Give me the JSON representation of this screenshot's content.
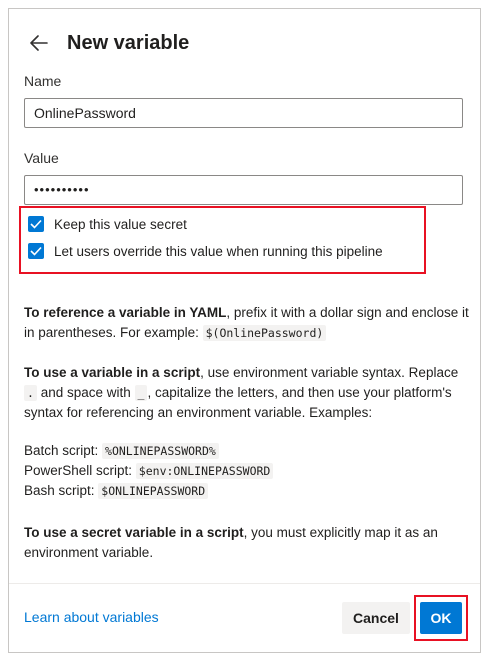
{
  "header": {
    "title": "New variable"
  },
  "name_field": {
    "label": "Name",
    "value": "OnlinePassword"
  },
  "value_field": {
    "label": "Value",
    "value": "••••••••••"
  },
  "options": {
    "keep_secret": {
      "label": "Keep this value secret",
      "checked": true
    },
    "allow_override": {
      "label": "Let users override this value when running this pipeline",
      "checked": true
    }
  },
  "help": {
    "p1_bold": "To reference a variable in YAML",
    "p1_text": ", prefix it with a dollar sign and enclose it in parentheses. For example: ",
    "p1_code": "$(OnlinePassword)",
    "p2_bold": "To use a variable in a script",
    "p2_text1": ", use environment variable syntax. Replace ",
    "p2_code1": ".",
    "p2_text2": " and space with ",
    "p2_code2": "_",
    "p2_text3": ", capitalize the letters, and then use your platform's syntax for referencing an environment variable. Examples:",
    "ex1_label": "Batch script: ",
    "ex1_code": "%ONLINEPASSWORD%",
    "ex2_label": "PowerShell script: ",
    "ex2_code": "$env:ONLINEPASSWORD",
    "ex3_label": "Bash script: ",
    "ex3_code": "$ONLINEPASSWORD",
    "p3_bold": "To use a secret variable in a script",
    "p3_text": ", you must explicitly map it as an environment variable."
  },
  "footer": {
    "learn_link": "Learn about variables",
    "cancel_label": "Cancel",
    "ok_label": "OK"
  },
  "colors": {
    "accent": "#0078d4",
    "highlight": "#e81123",
    "link": "#0078d4"
  },
  "icons": {
    "back": "arrow-left-icon",
    "check": "checkmark-icon"
  }
}
